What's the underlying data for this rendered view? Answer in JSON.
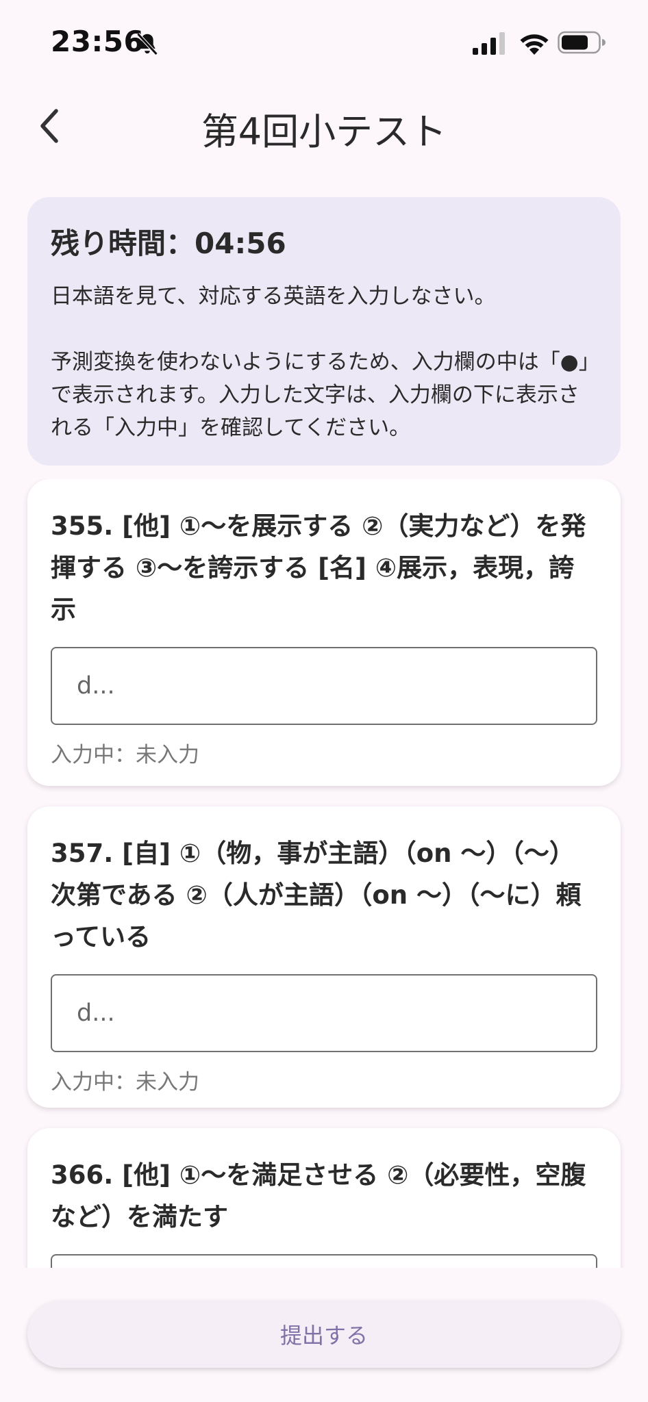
{
  "status_bar": {
    "time": "23:56",
    "icons": [
      "bell-slash-icon",
      "signal-icon",
      "wifi-icon",
      "battery-icon"
    ]
  },
  "app_bar": {
    "back_icon": "chevron-left-icon",
    "title": "第4回小テスト"
  },
  "info": {
    "timer": "残り時間：04:56",
    "instruction": "日本語を見て、対応する英語を入力しなさい。\n\n予測変換を使わないようにするため、入力欄の中は「●」で表示されます。入力した文字は、入力欄の下に表示される「入力中」を確認してください。"
  },
  "questions": [
    {
      "text": "355. [他] ①～を展示する ②（実力など）を発揮する ③～を誇示する [名] ④展示，表現，誇示",
      "placeholder": "d...",
      "status": "入力中：未入力"
    },
    {
      "text": "357. [自] ①（物，事が主語）（on ～）（～）次第である ②（人が主語）（on ～）（～に）頼っている",
      "placeholder": "d...",
      "status": "入力中：未入力"
    },
    {
      "text": "366. [他] ①～を満足させる ②（必要性，空腹など）を満たす",
      "placeholder": "",
      "status": ""
    }
  ],
  "submit_label": "提出する",
  "colors": {
    "background": "#fdf6fb",
    "info_card": "#ede8f5",
    "submit_text": "#7e72a6"
  }
}
